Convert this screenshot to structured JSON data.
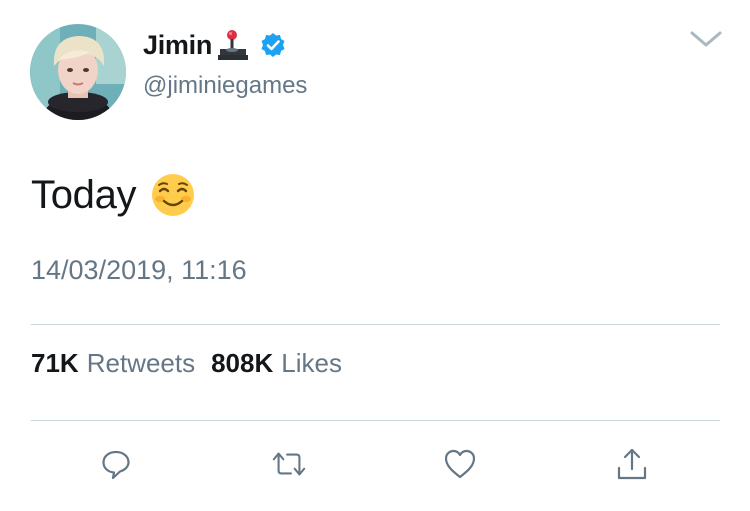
{
  "author": {
    "display_name": "Jimin",
    "handle": "@jiminiegames",
    "name_emoji": "joystick-icon",
    "verified": true,
    "verified_color": "#1da1f2"
  },
  "tweet": {
    "text": "Today",
    "emoji": "smiling-face-icon",
    "timestamp": "14/03/2019, 11:16"
  },
  "stats": {
    "retweets_count": "71K",
    "retweets_label": "Retweets",
    "likes_count": "808K",
    "likes_label": "Likes"
  },
  "actions": [
    "reply-icon",
    "retweet-icon",
    "like-icon",
    "share-icon"
  ],
  "colors": {
    "text_primary": "#14171a",
    "text_secondary": "#657786",
    "divider": "#ccd6dd",
    "icon_gray": "#657786"
  }
}
